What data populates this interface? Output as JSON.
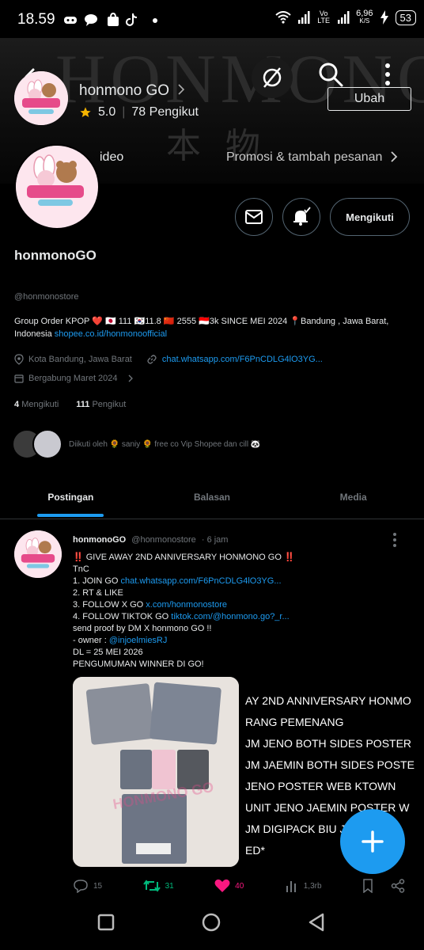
{
  "status_bar": {
    "time": "18.59",
    "network": "Vo LTE",
    "speed": "6,96",
    "speed_unit": "K/S",
    "battery": "53"
  },
  "banner": {
    "word": "HONMONO",
    "kanji": "本 物"
  },
  "header": {
    "overlay_name": "honmono GO",
    "rating": "5.0",
    "followers_text": "78 Pengikut",
    "edit_label": "Ubah",
    "video_label": "ideo",
    "promo_label": "Promosi & tambah pesanan"
  },
  "profile": {
    "follow_label": "Mengikuti",
    "display_name": "honmonoGO",
    "handle": "@honmonostore",
    "bio_text": "Group Order KPOP ❤️ 🇯🇵 111 🇰🇷11.8 🇨🇳 2555 🇮🇩3k  SINCE MEI 2024  📍Bandung , Jawa Barat, Indonesia ",
    "bio_link": "shopee.co.id/honmonoofficial",
    "location": "Kota Bandung, Jawa Barat",
    "website": "chat.whatsapp.com/F6PnCDLG4lO3YG...",
    "joined": "Bergabung Maret 2024",
    "following_count": "4",
    "following_label": "Mengikuti",
    "followers_count": "111",
    "followers_label": "Pengikut",
    "followed_by": "Diikuti oleh 🌻 saniy 🌻 free co Vip Shopee dan cill 🐼"
  },
  "tabs": [
    "Postingan",
    "Balasan",
    "Media"
  ],
  "tweet": {
    "name": "honmonoGO",
    "handle": "@honmonostore",
    "time": "· 6 jam",
    "lines": [
      {
        "text": "‼️ GIVE AWAY 2ND ANNIVERSARY HONMONO GO ‼️",
        "link": ""
      },
      {
        "text": "TnC",
        "link": ""
      },
      {
        "text": "1. JOIN GO  ",
        "link": "chat.whatsapp.com/F6PnCDLG4lO3YG..."
      },
      {
        "text": "2. RT & LIKE",
        "link": ""
      },
      {
        "text": "3. FOLLOW X GO ",
        "link": "x.com/honmonostore"
      },
      {
        "text": "4. FOLLOW TIKTOK GO ",
        "link": "tiktok.com/@honmono.go?_r..."
      },
      {
        "text": "send proof by DM X honmono GO !!",
        "link": ""
      },
      {
        "text": "- owner : ",
        "link": "@injoelmiesRJ"
      },
      {
        "text": "DL =  25 MEI 2026",
        "link": ""
      },
      {
        "text": "PENGUMUMAN WINNER DI GO!",
        "link": ""
      }
    ],
    "media_watermark": "HONMONO GO",
    "overflow_lines": [
      "AY 2ND ANNIVERSARY HONMO",
      "RANG PEMENANG",
      "JM JENO BOTH SIDES POSTER",
      "JM JAEMIN BOTH SIDES POSTE",
      "JENO POSTER WEB KTOWN",
      "UNIT JENO JAEMIN POSTER W",
      "JM DIGIPACK BIU J",
      "ED*"
    ],
    "actions": {
      "replies": "15",
      "retweets": "31",
      "likes": "40",
      "views": "1,3rb"
    }
  },
  "colors": {
    "accent": "#1d9bf0",
    "retweet": "#00ba7c",
    "like": "#f91880",
    "star": "#f5b400"
  }
}
